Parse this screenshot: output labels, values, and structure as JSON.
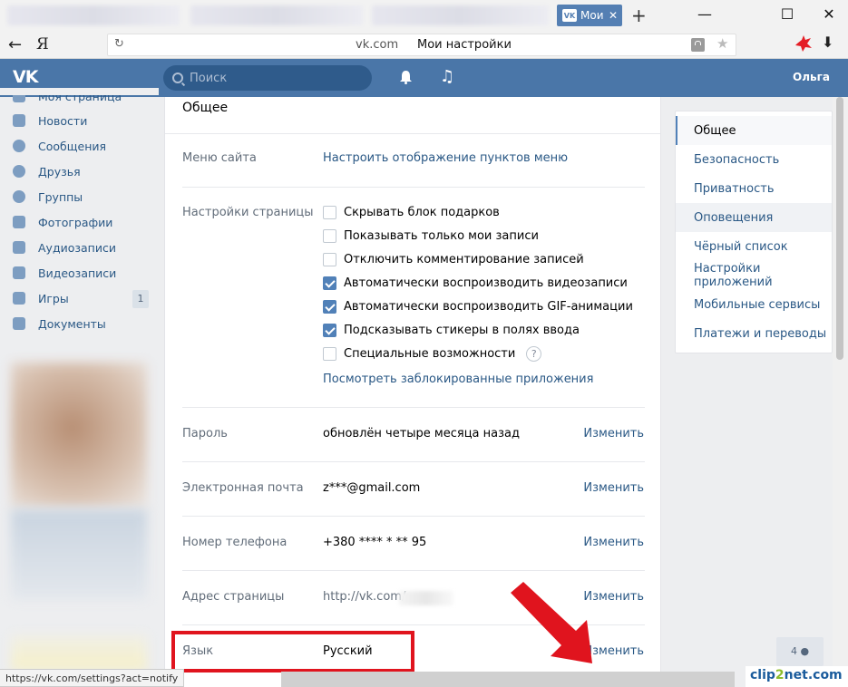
{
  "browser": {
    "tab_title": "Мои",
    "tab_close": "✕",
    "new_tab": "+",
    "minimize": "—",
    "maximize": "☐",
    "close": "✕",
    "back": "←",
    "yandex_logo": "Я",
    "reload": "↻",
    "url_host": "vk.com",
    "url_title": "Мои настройки",
    "star": "★",
    "download": "⬇"
  },
  "header": {
    "logo": "VK",
    "search_placeholder": "Поиск",
    "music": "♫",
    "user_name": "Ольга"
  },
  "left_menu": {
    "items": [
      {
        "label": "Моя страница",
        "icon": "home-icon"
      },
      {
        "label": "Новости",
        "icon": "news-icon"
      },
      {
        "label": "Сообщения",
        "icon": "messages-icon"
      },
      {
        "label": "Друзья",
        "icon": "friends-icon"
      },
      {
        "label": "Группы",
        "icon": "groups-icon"
      },
      {
        "label": "Фотографии",
        "icon": "camera-icon"
      },
      {
        "label": "Аудиозаписи",
        "icon": "music-icon"
      },
      {
        "label": "Видеозаписи",
        "icon": "video-icon"
      },
      {
        "label": "Игры",
        "icon": "games-icon",
        "badge": "1"
      },
      {
        "label": "Документы",
        "icon": "document-icon"
      }
    ]
  },
  "settings": {
    "title": "Общее",
    "menu_label": "Меню сайта",
    "menu_link": "Настроить отображение пунктов меню",
    "page_label": "Настройки страницы",
    "checkboxes": [
      {
        "label": "Скрывать блок подарков",
        "checked": false
      },
      {
        "label": "Показывать только мои записи",
        "checked": false
      },
      {
        "label": "Отключить комментирование записей",
        "checked": false
      },
      {
        "label": "Автоматически воспроизводить видеозаписи",
        "checked": true
      },
      {
        "label": "Автоматически воспроизводить GIF-анимации",
        "checked": true
      },
      {
        "label": "Подсказывать стикеры в полях ввода",
        "checked": true
      },
      {
        "label": "Специальные возможности",
        "checked": false
      }
    ],
    "help": "?",
    "blocked_apps_link": "Посмотреть заблокированные приложения",
    "password_label": "Пароль",
    "password_value": "обновлён четыре месяца назад",
    "email_label": "Электронная почта",
    "email_value": "z***@gmail.com",
    "phone_label": "Номер телефона",
    "phone_value": "+380 **** * ** 95",
    "address_label": "Адрес страницы",
    "address_value": "http://vk.com/",
    "language_label": "Язык",
    "language_value": "Русский",
    "edit": "Изменить"
  },
  "right_menu": {
    "items": [
      {
        "label": "Общее",
        "active": true
      },
      {
        "label": "Безопасность"
      },
      {
        "label": "Приватность"
      },
      {
        "label": "Оповещения"
      },
      {
        "label": "Чёрный список"
      },
      {
        "label": "Настройки приложений"
      },
      {
        "label": "Мобильные сервисы"
      },
      {
        "label": "Платежи и переводы"
      }
    ]
  },
  "footer": {
    "status_url": "https://vk.com/settings?act=notify",
    "chat_count": "4",
    "watermark_a": "clip",
    "watermark_b": "2",
    "watermark_c": "net.com"
  },
  "colors": {
    "vk_blue": "#4a76a8",
    "link": "#2a5885",
    "highlight_red": "#e0141e"
  }
}
